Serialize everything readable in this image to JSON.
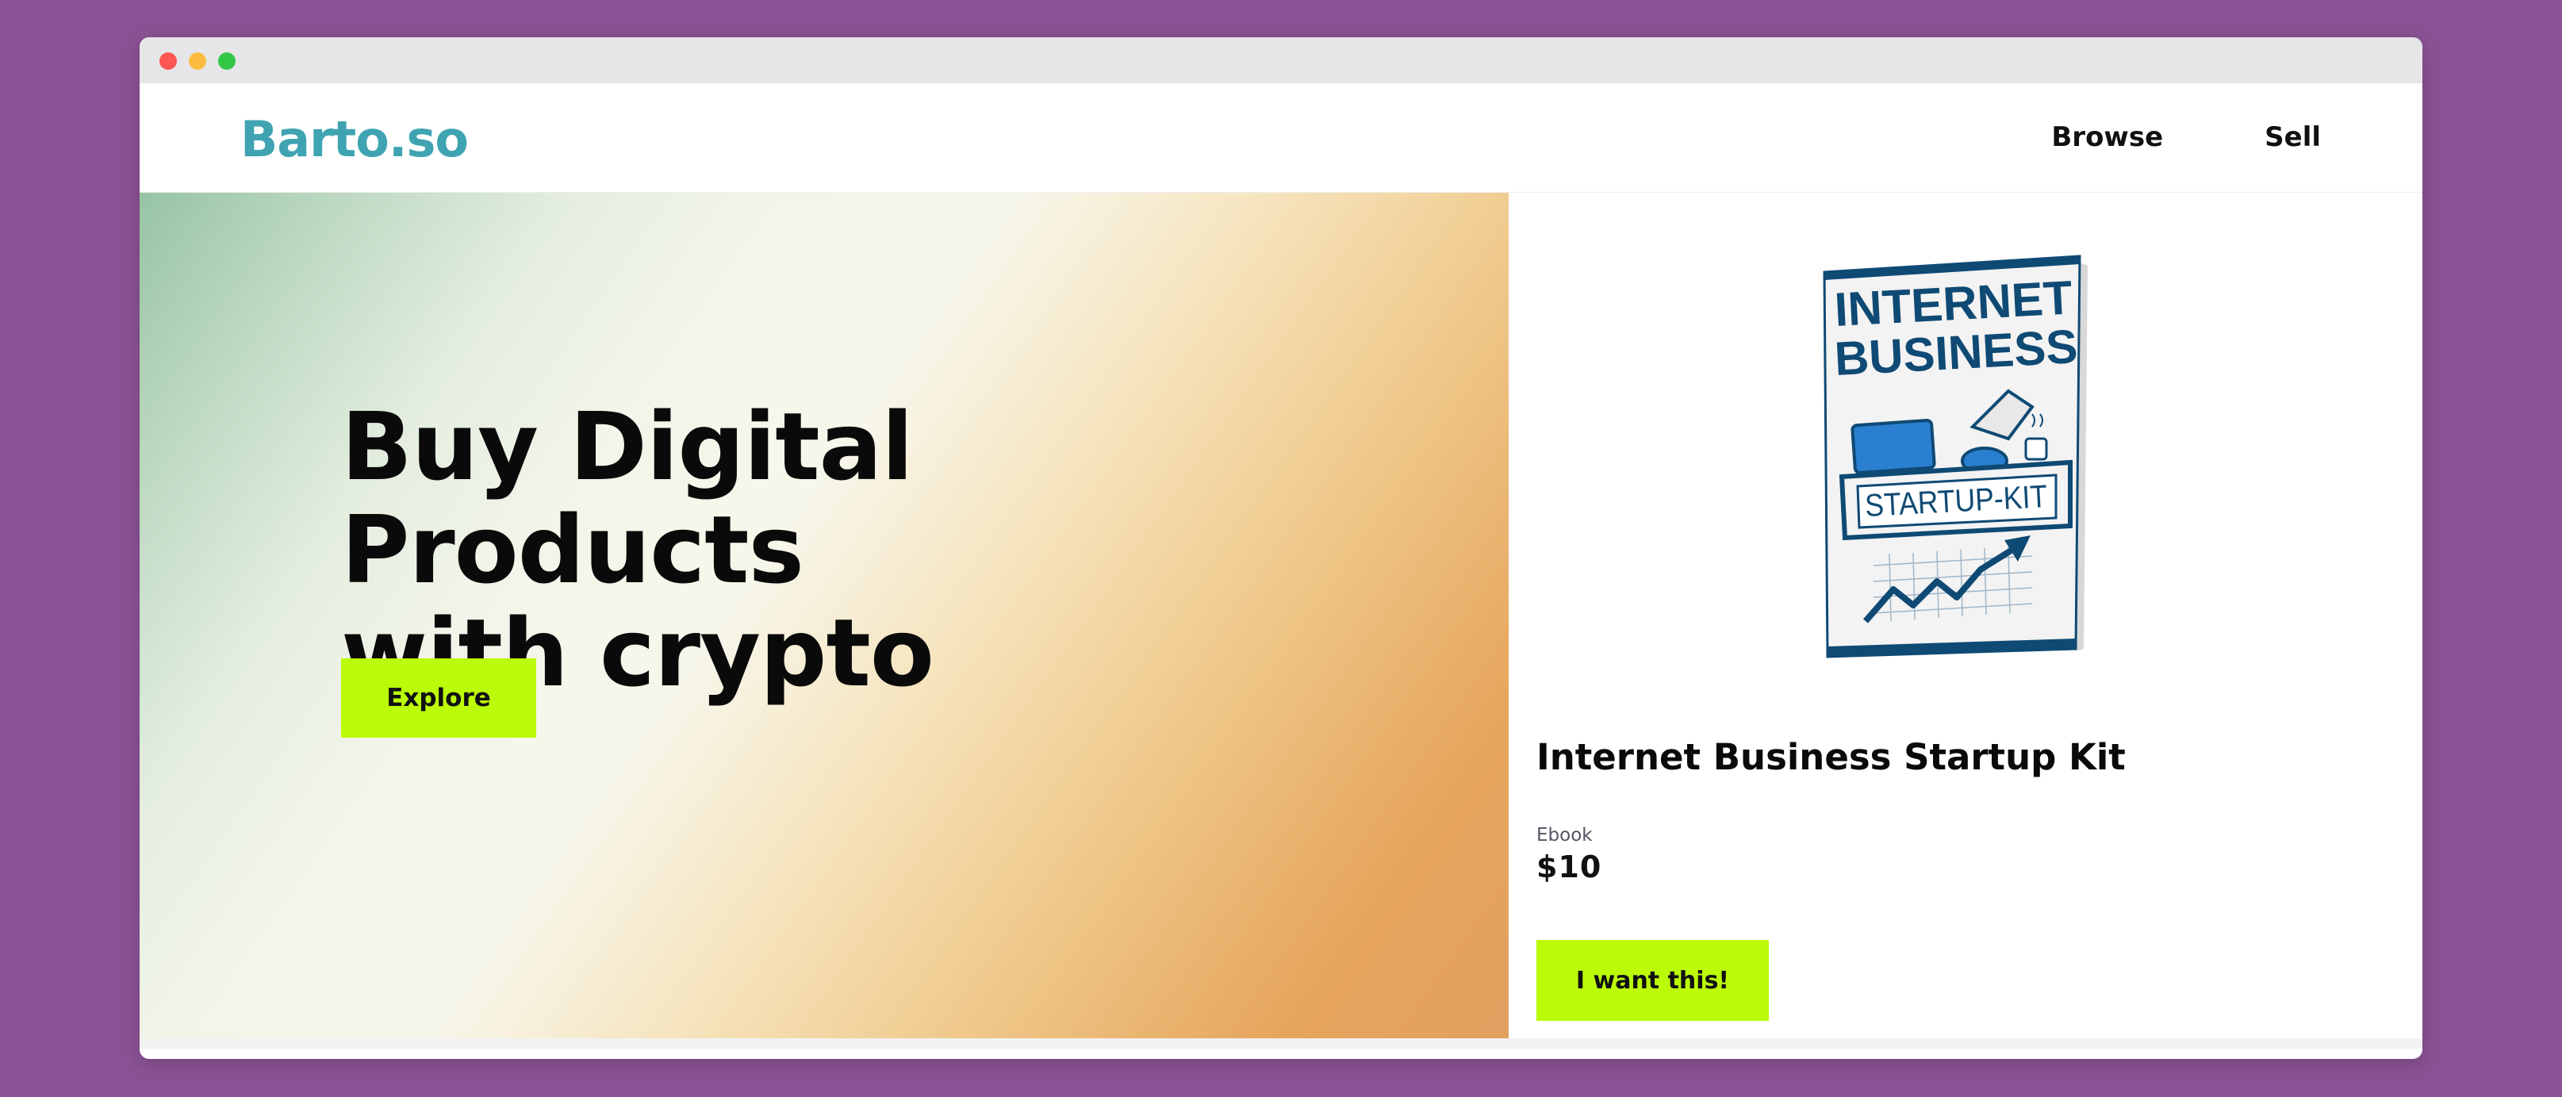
{
  "window": {
    "controls": [
      "close",
      "minimize",
      "maximize"
    ]
  },
  "header": {
    "logo": "Barto.so",
    "nav": [
      {
        "label": "Browse"
      },
      {
        "label": "Sell"
      }
    ]
  },
  "hero": {
    "title_line1": "Buy Digital Products",
    "title_line2": "with crypto",
    "cta_label": "Explore"
  },
  "product": {
    "cover_text_line1": "INTERNET",
    "cover_text_line2": "BUSINESS",
    "cover_banner": "STARTUP-KIT",
    "title": "Internet Business Startup Kit",
    "type": "Ebook",
    "price": "$10",
    "cta_label": "I want this!"
  },
  "colors": {
    "background": "#8a5294",
    "accent": "#bbfa09",
    "logo": "#3fa3b2",
    "cover_blue": "#0f4a74"
  }
}
